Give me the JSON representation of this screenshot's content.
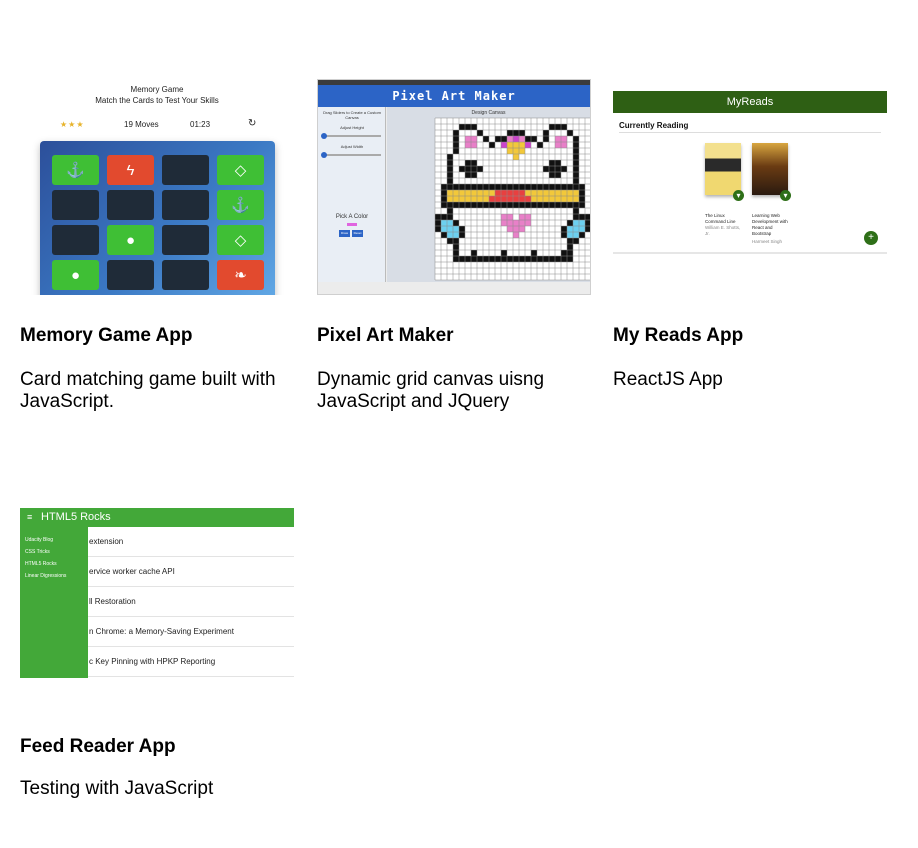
{
  "projects": [
    {
      "title": "Memory Game App",
      "description": "Card matching game built with JavaScript."
    },
    {
      "title": "Pixel Art Maker",
      "description": "Dynamic grid canvas uisng JavaScript and JQuery"
    },
    {
      "title": "My Reads App",
      "description": "ReactJS App"
    },
    {
      "title": "Feed Reader App",
      "description": "Testing with JavaScript"
    }
  ],
  "memory_game": {
    "title": "Memory Game",
    "subtitle": "Match the Cards to Test Your Skills",
    "stars": "★★★",
    "moves": "19 Moves",
    "timer": "01:23",
    "restart_icon": "↻",
    "tiles": [
      {
        "state": "g",
        "icon": "⚓",
        "icon_name": "anchor-icon"
      },
      {
        "state": "r",
        "icon": "ϟ",
        "icon_name": "bolt-icon"
      },
      {
        "state": "d",
        "icon": "",
        "icon_name": ""
      },
      {
        "state": "g",
        "icon": "◇",
        "icon_name": "diamond-icon"
      },
      {
        "state": "d",
        "icon": "",
        "icon_name": ""
      },
      {
        "state": "d",
        "icon": "",
        "icon_name": ""
      },
      {
        "state": "d",
        "icon": "",
        "icon_name": ""
      },
      {
        "state": "g",
        "icon": "⚓",
        "icon_name": "anchor-icon"
      },
      {
        "state": "d",
        "icon": "",
        "icon_name": ""
      },
      {
        "state": "g",
        "icon": "●",
        "icon_name": "bomb-icon"
      },
      {
        "state": "d",
        "icon": "",
        "icon_name": ""
      },
      {
        "state": "g",
        "icon": "◇",
        "icon_name": "diamond-icon"
      },
      {
        "state": "g",
        "icon": "●",
        "icon_name": "bomb-icon"
      },
      {
        "state": "d",
        "icon": "",
        "icon_name": ""
      },
      {
        "state": "d",
        "icon": "",
        "icon_name": ""
      },
      {
        "state": "r",
        "icon": "❧",
        "icon_name": "leaf-icon"
      }
    ],
    "colors": {
      "match": "#3fbf35",
      "wrong": "#e24a2e",
      "hidden": "#1f2b38"
    }
  },
  "pixel_art": {
    "banner": "Pixel Art Maker",
    "instructions": "Drag Sliders to Create a Custom Canvas",
    "height_label": "Adjust Height",
    "width_label": "Adjust Width",
    "pick_color": "Pick A Color",
    "draw_btn": "Draw",
    "reset_btn": "Reset",
    "canvas_title": "Design Canvas",
    "grid_cols": 26,
    "grid_rows": 27,
    "palette": {
      "k": "#111111",
      "w": "#ffffff",
      "p": "#e880c8",
      "m": "#cc44cc",
      "y": "#f2c83a",
      "r": "#e84040",
      "c": "#6cd0f0"
    },
    "art": [
      "..........................",
      "....kkk............kkk....",
      "...kwwwk....kkk...kwwwk...",
      "...kwppwk.kkpmpkk.kwppwk..",
      "...kwppwwkwmyyymwkwwppwk..",
      "...kwwwwwwwwyyywwwwwwwwk..",
      "..kwwwwwwwwwwywwwwwwwwwk..",
      "..kwwkkwwwwwwwwwwwwkkwwk..",
      "..kwkkkkwwwwwwwwwwkkkkwk..",
      "..kwwkkwwwwwwwwwwwwkkwwk..",
      "..kwwwwwwwwwwwwwwwwwwwwk..",
      ".kkkkkkkkkkkkkkkkkkkkkkkk.",
      ".kyyyyyyyyrrrrryyyyyyyyyk.",
      ".kyyyyyyyrrrrrrryyyyyyyyk.",
      ".kkkkkkkkkkkkkkkkkkkkkkkk.",
      "..kwwwwwwwwwwwwwwwwwwwwk..",
      "kkkwwwwwwwwppwppwwwwwwwkkk",
      "kcckwwwwwwwpppppwwwwwwkcck",
      "kccckwwwwwwwpppwwwwwwkccck",
      ".kcckwwwwwwwwpwwwwwwwkcck.",
      "..kkwwwwwwwwwwwwwwwwwwkk..",
      "...kwwwwwwwwwwwwwwwwwwk...",
      "...kwwkwwwwkwwwwkwwwwkk...",
      "...kkkkkkkkkkkkkkkkkkkk...",
      "..........................",
      "..........................",
      ".........................."
    ]
  },
  "my_reads": {
    "header": "MyReads",
    "shelf": "Currently Reading",
    "books": [
      {
        "title": "The Linux Command Line",
        "author": "William E. Shotts, Jr."
      },
      {
        "title": "Learning Web Development with React and Bootstrap",
        "author": "Harmeet Singh"
      }
    ],
    "add_icon": "+",
    "move_icon": "▾",
    "colors": {
      "header": "#2e5f14",
      "button": "#2e6f18"
    }
  },
  "feed_reader": {
    "header": "HTML5 Rocks",
    "menu_icon": "≡",
    "menu": [
      "Udacity Blog",
      "CSS Tricks",
      "HTML5 Rocks",
      "Linear Digressions"
    ],
    "entries": [
      "extension",
      "ervice worker cache API",
      "ll Restoration",
      "n Chrome: a Memory-Saving Experiment",
      "c Key Pinning with HPKP Reporting"
    ],
    "colors": {
      "header": "#43a839"
    }
  }
}
